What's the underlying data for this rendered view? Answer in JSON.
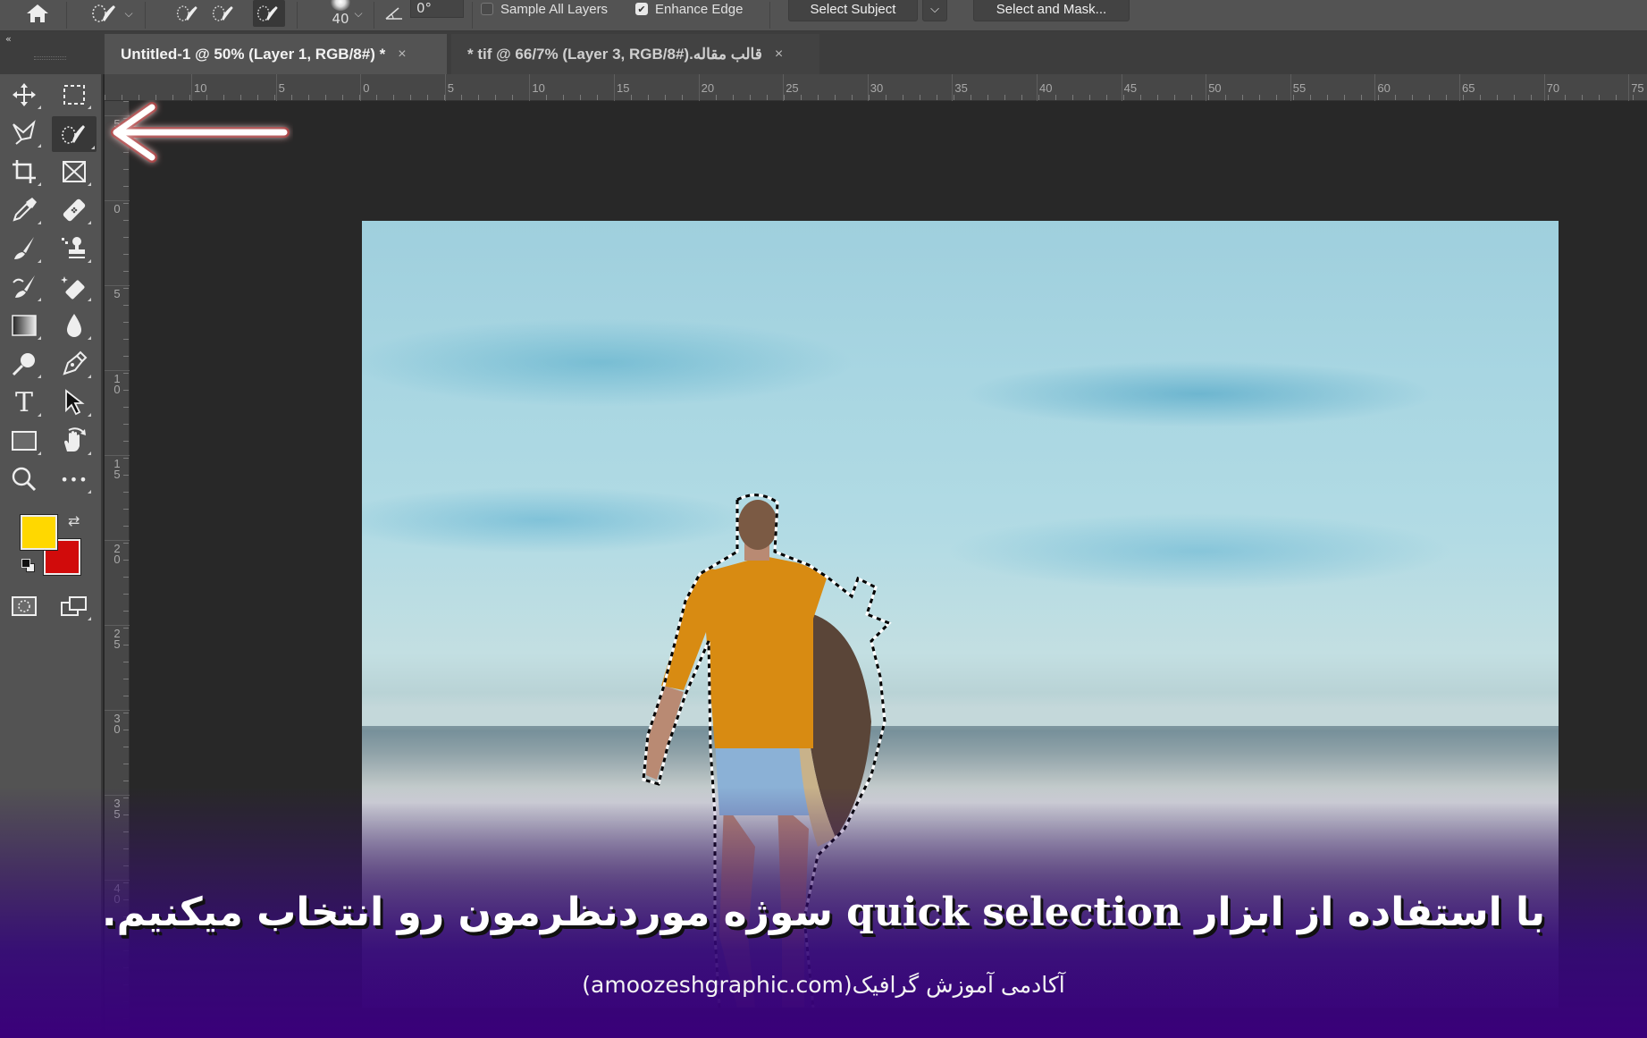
{
  "options_bar": {
    "home_icon": "home-icon",
    "tool_preset_icon": "quick-selection-brush-icon",
    "selection_modes": [
      "new-selection",
      "add-to-selection",
      "subtract-from-selection"
    ],
    "active_mode": "subtract-from-selection",
    "brush_size": "40",
    "angle_value": "0°",
    "sample_all_layers": {
      "label": "Sample All Layers",
      "checked": false
    },
    "enhance_edge": {
      "label": "Enhance Edge",
      "checked": true
    },
    "select_subject_label": "Select Subject",
    "select_and_mask_label": "Select and Mask..."
  },
  "tabs": {
    "collapse_label": "«",
    "items": [
      {
        "label": "Untitled-1 @ 50% (Layer 1, RGB/8#) *",
        "active": true,
        "close": "×"
      },
      {
        "label": "قالب مقاله.tif @ 66/7% (Layer 3, RGB/8#) *",
        "active": false,
        "close": "×"
      }
    ]
  },
  "toolbar": {
    "tools": [
      {
        "name": "move-tool",
        "icon": "move-icon"
      },
      {
        "name": "rectangular-marquee-tool",
        "icon": "marquee-icon"
      },
      {
        "name": "lasso-tool",
        "icon": "polygonal-lasso-icon"
      },
      {
        "name": "quick-selection-tool",
        "icon": "quick-selection-icon",
        "active": true
      },
      {
        "name": "crop-tool",
        "icon": "crop-icon"
      },
      {
        "name": "frame-tool",
        "icon": "frame-icon"
      },
      {
        "name": "eyedropper-tool",
        "icon": "eyedropper-icon"
      },
      {
        "name": "healing-brush-tool",
        "icon": "bandage-icon"
      },
      {
        "name": "brush-tool",
        "icon": "brush-icon"
      },
      {
        "name": "clone-stamp-tool",
        "icon": "stamp-icon"
      },
      {
        "name": "history-brush-tool",
        "icon": "history-brush-icon"
      },
      {
        "name": "eraser-tool",
        "icon": "eraser-icon"
      },
      {
        "name": "gradient-tool",
        "icon": "gradient-icon"
      },
      {
        "name": "blur-tool",
        "icon": "drop-icon"
      },
      {
        "name": "dodge-tool",
        "icon": "dodge-icon"
      },
      {
        "name": "pen-tool",
        "icon": "pen-icon"
      },
      {
        "name": "type-tool",
        "icon": "type-icon",
        "glyph": "T"
      },
      {
        "name": "path-selection-tool",
        "icon": "arrow-cursor-icon"
      },
      {
        "name": "rectangle-tool",
        "icon": "rectangle-icon"
      },
      {
        "name": "hand-rotate-tool",
        "icon": "hand-icon"
      },
      {
        "name": "zoom-tool",
        "icon": "zoom-icon"
      },
      {
        "name": "edit-toolbar",
        "icon": "more-icon",
        "glyph": "•••"
      }
    ],
    "foreground_color": "#FFD800",
    "background_color": "#D10B0B",
    "swap_glyph": "⇄",
    "quick_mask_icon": "quick-mask-icon",
    "screen_mode_icon": "screen-mode-icon"
  },
  "rulers": {
    "horizontal_labels": [
      "10",
      "5",
      "0",
      "5",
      "10",
      "15",
      "20",
      "25",
      "30",
      "35",
      "40",
      "45",
      "50",
      "55",
      "60",
      "65",
      "70",
      "75"
    ],
    "vertical_labels": [
      "5",
      "0",
      "5",
      "10",
      "15",
      "20",
      "25",
      "30",
      "35",
      "40"
    ]
  },
  "annotation": {
    "arrow_color": "#FFFFFF",
    "arrow_glow": "#C0141A"
  },
  "caption": {
    "line1_part1": "با استفاده از ابزار",
    "line1_latin": "quick selection",
    "line1_part2": "سوژه موردنظرمون رو انتخاب میکنیم.",
    "line2": "آکادمی آموزش گرافیک(amoozeshgraphic.com)"
  }
}
